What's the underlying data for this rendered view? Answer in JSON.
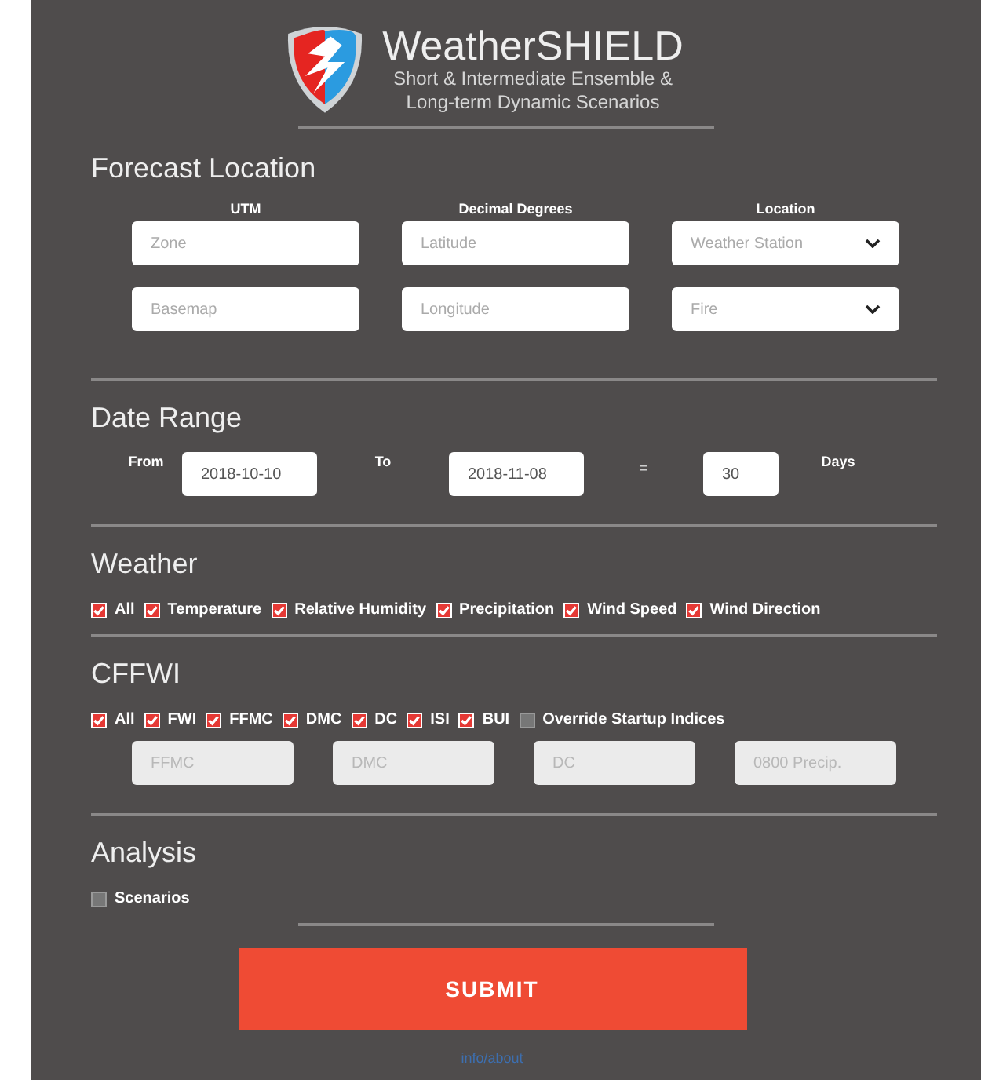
{
  "header": {
    "title": "WeatherSHIELD",
    "subtitle_lines": [
      "Short & Intermediate Ensemble &",
      "Long-term Dynamic Scenarios"
    ]
  },
  "forecast_location": {
    "title": "Forecast Location",
    "columns": [
      {
        "heading": "UTM",
        "fields": [
          {
            "kind": "text",
            "placeholder": "Zone"
          },
          {
            "kind": "text",
            "placeholder": "Basemap"
          }
        ]
      },
      {
        "heading": "Decimal Degrees",
        "fields": [
          {
            "kind": "text",
            "placeholder": "Latitude"
          },
          {
            "kind": "text",
            "placeholder": "Longitude"
          }
        ]
      },
      {
        "heading": "Location",
        "fields": [
          {
            "kind": "select",
            "placeholder": "Weather Station"
          },
          {
            "kind": "select",
            "placeholder": "Fire"
          }
        ]
      }
    ]
  },
  "date_range": {
    "title": "Date Range",
    "from_label": "From",
    "from_value": "2018-10-10",
    "to_label": "To",
    "to_value": "2018-11-08",
    "equals": "=",
    "days_value": "30",
    "days_label": "Days"
  },
  "weather": {
    "title": "Weather",
    "options": [
      {
        "label": "All",
        "checked": true
      },
      {
        "label": "Temperature",
        "checked": true
      },
      {
        "label": "Relative Humidity",
        "checked": true
      },
      {
        "label": "Precipitation",
        "checked": true
      },
      {
        "label": "Wind Speed",
        "checked": true
      },
      {
        "label": "Wind Direction",
        "checked": true
      }
    ]
  },
  "cffwi": {
    "title": "CFFWI",
    "options": [
      {
        "label": "All",
        "checked": true
      },
      {
        "label": "FWI",
        "checked": true
      },
      {
        "label": "FFMC",
        "checked": true
      },
      {
        "label": "DMC",
        "checked": true
      },
      {
        "label": "DC",
        "checked": true
      },
      {
        "label": "ISI",
        "checked": true
      },
      {
        "label": "BUI",
        "checked": true
      },
      {
        "label": "Override Startup Indices",
        "checked": false
      }
    ],
    "fields": [
      {
        "placeholder": "FFMC",
        "disabled": true
      },
      {
        "placeholder": "DMC",
        "disabled": true
      },
      {
        "placeholder": "DC",
        "disabled": true
      },
      {
        "placeholder": "0800 Precip.",
        "disabled": true
      }
    ]
  },
  "analysis": {
    "title": "Analysis",
    "options": [
      {
        "label": "Scenarios",
        "checked": false
      }
    ]
  },
  "submit": "SUBMIT",
  "footer_link": "info/about"
}
